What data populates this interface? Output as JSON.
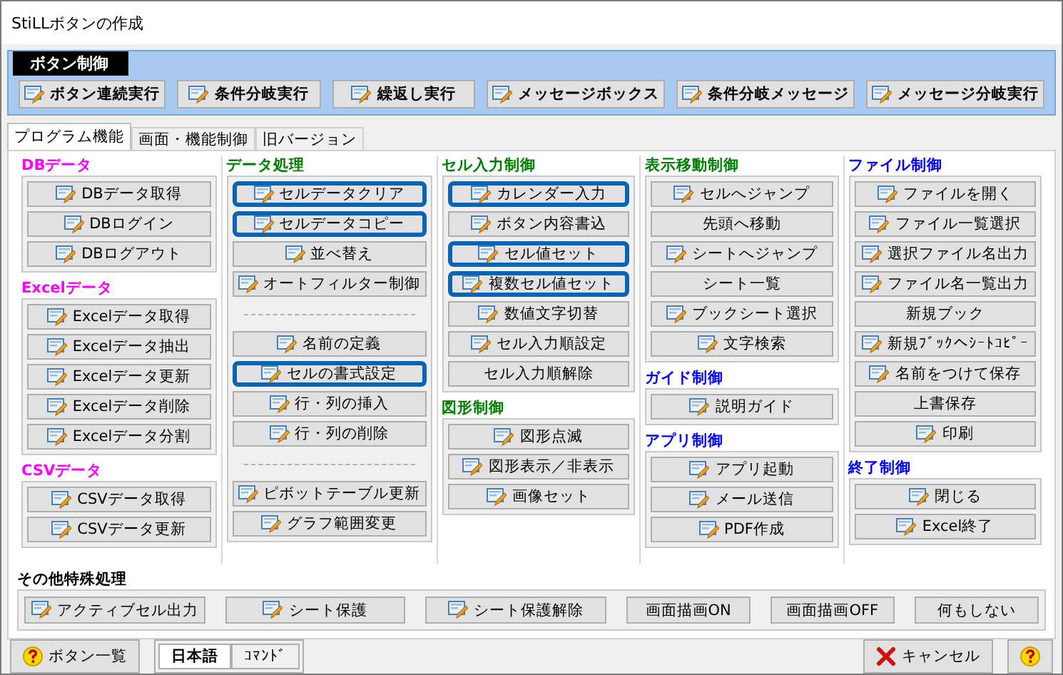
{
  "window": {
    "title": "StiLLボタンの作成"
  },
  "ribbon": {
    "title": "ボタン制御",
    "buttons": [
      {
        "label": "ボタン連続実行",
        "icon": true
      },
      {
        "label": "条件分岐実行",
        "icon": true
      },
      {
        "label": "繰返し実行",
        "icon": true
      },
      {
        "label": "メッセージボックス",
        "icon": true
      },
      {
        "label": "条件分岐メッセージ",
        "icon": true
      },
      {
        "label": "メッセージ分岐実行",
        "icon": true
      }
    ]
  },
  "tabs": [
    {
      "label": "プログラム機能",
      "selected": true
    },
    {
      "label": "画面・機能制御",
      "selected": false
    },
    {
      "label": "旧バージョン",
      "selected": false
    }
  ],
  "columns": [
    {
      "groups": [
        {
          "title": "DBデータ",
          "color": "#ff00ff",
          "items": [
            {
              "kind": "button",
              "label": "DBデータ取得",
              "icon": true,
              "highlighted": false
            },
            {
              "kind": "button",
              "label": "DBログイン",
              "icon": true,
              "highlighted": false
            },
            {
              "kind": "button",
              "label": "DBログアウト",
              "icon": true,
              "highlighted": false
            }
          ]
        },
        {
          "title": "Excelデータ",
          "color": "#ff00ff",
          "items": [
            {
              "kind": "button",
              "label": "Excelデータ取得",
              "icon": true,
              "highlighted": false
            },
            {
              "kind": "button",
              "label": "Excelデータ抽出",
              "icon": true,
              "highlighted": false
            },
            {
              "kind": "button",
              "label": "Excelデータ更新",
              "icon": true,
              "highlighted": false
            },
            {
              "kind": "button",
              "label": "Excelデータ削除",
              "icon": true,
              "highlighted": false
            },
            {
              "kind": "button",
              "label": "Excelデータ分割",
              "icon": true,
              "highlighted": false
            }
          ]
        },
        {
          "title": "CSVデータ",
          "color": "#ff00ff",
          "items": [
            {
              "kind": "button",
              "label": "CSVデータ取得",
              "icon": true,
              "highlighted": false
            },
            {
              "kind": "button",
              "label": "CSVデータ更新",
              "icon": true,
              "highlighted": false
            }
          ]
        }
      ]
    },
    {
      "groups": [
        {
          "title": "データ処理",
          "color": "#008000",
          "items": [
            {
              "kind": "button",
              "label": "セルデータクリア",
              "icon": true,
              "highlighted": true
            },
            {
              "kind": "button",
              "label": "セルデータコピー",
              "icon": true,
              "highlighted": true
            },
            {
              "kind": "button",
              "label": "並べ替え",
              "icon": true,
              "highlighted": false
            },
            {
              "kind": "button",
              "label": "オートフィルター制御",
              "icon": true,
              "highlighted": false
            },
            {
              "kind": "separator"
            },
            {
              "kind": "button",
              "label": "名前の定義",
              "icon": true,
              "highlighted": false
            },
            {
              "kind": "button",
              "label": "セルの書式設定",
              "icon": true,
              "highlighted": true
            },
            {
              "kind": "button",
              "label": "行・列の挿入",
              "icon": true,
              "highlighted": false
            },
            {
              "kind": "button",
              "label": "行・列の削除",
              "icon": true,
              "highlighted": false
            },
            {
              "kind": "separator"
            },
            {
              "kind": "button",
              "label": "ピボットテーブル更新",
              "icon": true,
              "highlighted": false
            },
            {
              "kind": "button",
              "label": "グラフ範囲変更",
              "icon": true,
              "highlighted": false
            }
          ]
        }
      ]
    },
    {
      "groups": [
        {
          "title": "セル入力制御",
          "color": "#008000",
          "items": [
            {
              "kind": "button",
              "label": "カレンダー入力",
              "icon": true,
              "highlighted": true
            },
            {
              "kind": "button",
              "label": "ボタン内容書込",
              "icon": true,
              "highlighted": false
            },
            {
              "kind": "button",
              "label": "セル値セット",
              "icon": true,
              "highlighted": true
            },
            {
              "kind": "button",
              "label": "複数セル値セット",
              "icon": true,
              "highlighted": true
            },
            {
              "kind": "button",
              "label": "数値文字切替",
              "icon": true,
              "highlighted": false
            },
            {
              "kind": "button",
              "label": "セル入力順設定",
              "icon": true,
              "highlighted": false
            },
            {
              "kind": "button",
              "label": "セル入力順解除",
              "icon": false,
              "highlighted": false
            }
          ]
        },
        {
          "title": "図形制御",
          "color": "#008000",
          "items": [
            {
              "kind": "button",
              "label": "図形点滅",
              "icon": true,
              "highlighted": false
            },
            {
              "kind": "button",
              "label": "図形表示／非表示",
              "icon": true,
              "highlighted": false
            },
            {
              "kind": "button",
              "label": "画像セット",
              "icon": true,
              "highlighted": false
            }
          ]
        }
      ]
    },
    {
      "groups": [
        {
          "title": "表示移動制御",
          "color": "#008000",
          "items": [
            {
              "kind": "button",
              "label": "セルへジャンプ",
              "icon": true,
              "highlighted": false
            },
            {
              "kind": "button",
              "label": "先頭へ移動",
              "icon": false,
              "highlighted": false
            },
            {
              "kind": "button",
              "label": "シートへジャンプ",
              "icon": true,
              "highlighted": false
            },
            {
              "kind": "button",
              "label": "シート一覧",
              "icon": false,
              "highlighted": false
            },
            {
              "kind": "button",
              "label": "ブックシート選択",
              "icon": true,
              "highlighted": false
            },
            {
              "kind": "button",
              "label": "文字検索",
              "icon": true,
              "highlighted": false
            }
          ]
        },
        {
          "title": "ガイド制御",
          "color": "#0000ff",
          "items": [
            {
              "kind": "button",
              "label": "説明ガイド",
              "icon": true,
              "highlighted": false
            }
          ]
        },
        {
          "title": "アプリ制御",
          "color": "#0000ff",
          "items": [
            {
              "kind": "button",
              "label": "アプリ起動",
              "icon": true,
              "highlighted": false
            },
            {
              "kind": "button",
              "label": "メール送信",
              "icon": true,
              "highlighted": false
            },
            {
              "kind": "button",
              "label": "PDF作成",
              "icon": true,
              "highlighted": false
            }
          ]
        }
      ]
    },
    {
      "groups": [
        {
          "title": "ファイル制御",
          "color": "#0000ff",
          "items": [
            {
              "kind": "button",
              "label": "ファイルを開く",
              "icon": true,
              "highlighted": false
            },
            {
              "kind": "button",
              "label": "ファイル一覧選択",
              "icon": true,
              "highlighted": false
            },
            {
              "kind": "button",
              "label": "選択ファイル名出力",
              "icon": true,
              "highlighted": false
            },
            {
              "kind": "button",
              "label": "ファイル名一覧出力",
              "icon": true,
              "highlighted": false
            },
            {
              "kind": "button",
              "label": "新規ブック",
              "icon": false,
              "highlighted": false
            },
            {
              "kind": "button",
              "label": "新規ﾌﾞｯｸへｼｰﾄｺﾋﾟｰ",
              "icon": true,
              "highlighted": false
            },
            {
              "kind": "button",
              "label": "名前をつけて保存",
              "icon": true,
              "highlighted": false
            },
            {
              "kind": "button",
              "label": "上書保存",
              "icon": false,
              "highlighted": false
            },
            {
              "kind": "button",
              "label": "印刷",
              "icon": true,
              "highlighted": false
            }
          ]
        },
        {
          "title": "終了制御",
          "color": "#0000ff",
          "items": [
            {
              "kind": "button",
              "label": "閉じる",
              "icon": true,
              "highlighted": false
            },
            {
              "kind": "button",
              "label": "Excel終了",
              "icon": true,
              "highlighted": false
            }
          ]
        }
      ]
    }
  ],
  "other": {
    "title": "その他特殊処理",
    "buttons": [
      {
        "label": "アクティブセル出力",
        "icon": true
      },
      {
        "label": "シート保護",
        "icon": true
      },
      {
        "label": "シート保護解除",
        "icon": true
      },
      {
        "label": "画面描画ON",
        "icon": false
      },
      {
        "label": "画面描画OFF",
        "icon": false
      },
      {
        "label": "何もしない",
        "icon": false
      }
    ]
  },
  "footer": {
    "list_button": "ボタン一覧",
    "languages": [
      {
        "label": "日本語",
        "selected": true
      },
      {
        "label": "ｺﾏﾝﾄﾞ",
        "selected": false
      }
    ],
    "cancel_button": "キャンセル"
  }
}
